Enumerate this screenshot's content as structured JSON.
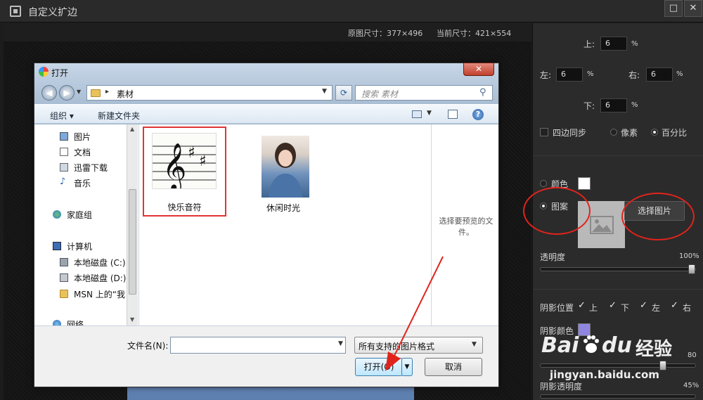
{
  "app": {
    "title": "自定义扩边",
    "min_label": "□",
    "close_label": "✕"
  },
  "canvas": {
    "original_size": "原图尺寸：377×496",
    "current_size": "当前尺寸：421×554"
  },
  "panel": {
    "top_label": "上:",
    "top_value": "6",
    "left_label": "左:",
    "left_value": "6",
    "right_label": "右:",
    "right_value": "6",
    "bottom_label": "下:",
    "bottom_value": "6",
    "percent": "%",
    "sync_label": "四边同步",
    "pixel_label": "像素",
    "percent_label": "百分比",
    "color_label": "颜色",
    "pattern_label": "图案",
    "choose_image": "选择图片",
    "opacity_label": "透明度",
    "opacity_value": "100%",
    "shadow_position_label": "阴影位置",
    "shadow_up": "上",
    "shadow_down": "下",
    "shadow_left": "左",
    "shadow_right": "右",
    "shadow_color_label": "阴影颜色",
    "shadow_amount_value": "80",
    "shadow_opacity_label": "阴影透明度",
    "shadow_opacity_value": "45%",
    "colors": {
      "white": "#ffffff",
      "shadow": "#8f86e0"
    }
  },
  "dialog": {
    "title": "打开",
    "address_folder": "素材",
    "search_placeholder": "搜索 素材",
    "organize": "组织 ▾",
    "new_folder": "新建文件夹",
    "nav_items": [
      "图片",
      "文档",
      "迅雷下载",
      "音乐",
      "家庭组",
      "计算机",
      "本地磁盘 (C:)",
      "本地磁盘 (D:)",
      "MSN 上的“我",
      "网络"
    ],
    "files": [
      {
        "name": "快乐音符"
      },
      {
        "name": "休闲时光"
      }
    ],
    "preview_text": "选择要预览的文件。",
    "filename_label": "文件名(N):",
    "filename_value": "",
    "filetype": "所有支持的图片格式",
    "open_button": "打开(O)",
    "cancel_button": "取消"
  },
  "watermark": {
    "brand": "Bai",
    "brand2": "du",
    "jingyan": "经验",
    "url": "jingyan.baidu.com"
  }
}
